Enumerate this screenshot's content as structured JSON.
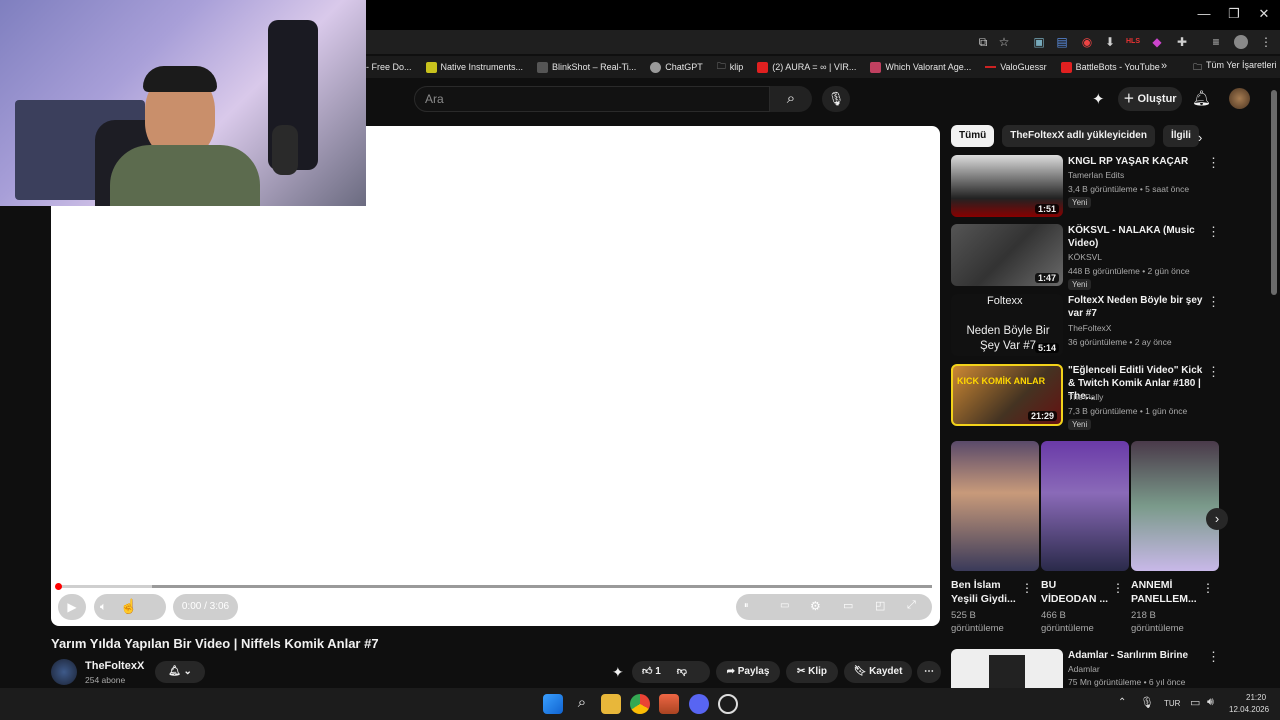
{
  "window": {
    "minimize": "—",
    "restore": "❐",
    "close": "✕"
  },
  "bookmarks": [
    {
      "label": "- Free Do...",
      "color": "#e23b2e"
    },
    {
      "label": "Native Instruments...",
      "color": "#c8c21d"
    },
    {
      "label": "BlinkShot – Real-Ti...",
      "color": "#555555"
    },
    {
      "label": "ChatGPT",
      "color": "#9a9a9a"
    },
    {
      "label": "klip",
      "color": "#777777"
    },
    {
      "label": "(2) AURA = ∞ | VIR...",
      "color": "#e02020"
    },
    {
      "label": "Which Valorant Age...",
      "color": "#c04060"
    },
    {
      "label": "ValoGuessr",
      "color": "#cc2222"
    },
    {
      "label": "BattleBots - YouTube",
      "color": "#e02020"
    }
  ],
  "all_bookmarks": "Tüm Yer İşaretleri",
  "header": {
    "search_placeholder": "Ara",
    "create": "Oluştur"
  },
  "player": {
    "time": "0:00 / 3:06"
  },
  "video": {
    "title": "Yarım Yılda Yapılan Bir Video | Niffels Komik Anlar #7",
    "channel": "TheFoltexX",
    "subscribers": "254 abone",
    "likes": "1",
    "share": "Paylaş",
    "clip": "Klip",
    "save": "Kaydet"
  },
  "chips": [
    "Tümü",
    "TheFoltexX adlı yükleyiciden",
    "İlgili"
  ],
  "recommendations": [
    {
      "title": "KNGL RP YAŞAR KAÇAR",
      "channel": "Tamerlan Edits",
      "meta": "3,4 B görüntüleme • 5 saat önce",
      "badge": "Yeni",
      "duration": "1:51"
    },
    {
      "title": "KÖKSVL - NALAKA (Music Video)",
      "channel": "KÖKSVL",
      "meta": "448 B görüntüleme • 2 gün önce",
      "badge": "Yeni",
      "duration": "1:47"
    },
    {
      "title": "FoltexX Neden Böyle bir şey var #7",
      "channel": "TheFoltexX",
      "meta": "36 görüntüleme • 2 ay önce",
      "badge": "",
      "duration": "5:14",
      "thumb_top": "Foltexx",
      "thumb_bottom": "Neden Böyle Bir Şey Var #7"
    },
    {
      "title": "\"Eğlenceli Editli Video\" Kick & Twitch Komik Anlar #180 | The...",
      "channel": "The Pally",
      "meta": "7,3 B görüntüleme • 1 gün önce",
      "badge": "Yeni",
      "duration": "21:29",
      "thumb_text": "KICK KOMİK ANLAR"
    },
    {
      "title": "Adamlar - Sarılırım Birine",
      "channel": "Adamlar",
      "meta": "75 Mn görüntüleme • 6 yıl önce",
      "badge": "",
      "duration": ""
    }
  ],
  "shorts": [
    {
      "title": "Ben İslam Yeşili Giydi...",
      "views": "525 B",
      "suffix": "görüntüleme"
    },
    {
      "title": "BU VİDEODAN ...",
      "views": "466 B",
      "suffix": "görüntüleme"
    },
    {
      "title": "ANNEMİ PANELLEM...",
      "views": "218 B",
      "suffix": "görüntüleme"
    }
  ],
  "taskbar": {
    "lang": "TUR",
    "time": "21:20",
    "date": "12.04.2026"
  },
  "colors": {
    "bg": "#0f0f0f",
    "accent": "#ff0000"
  }
}
